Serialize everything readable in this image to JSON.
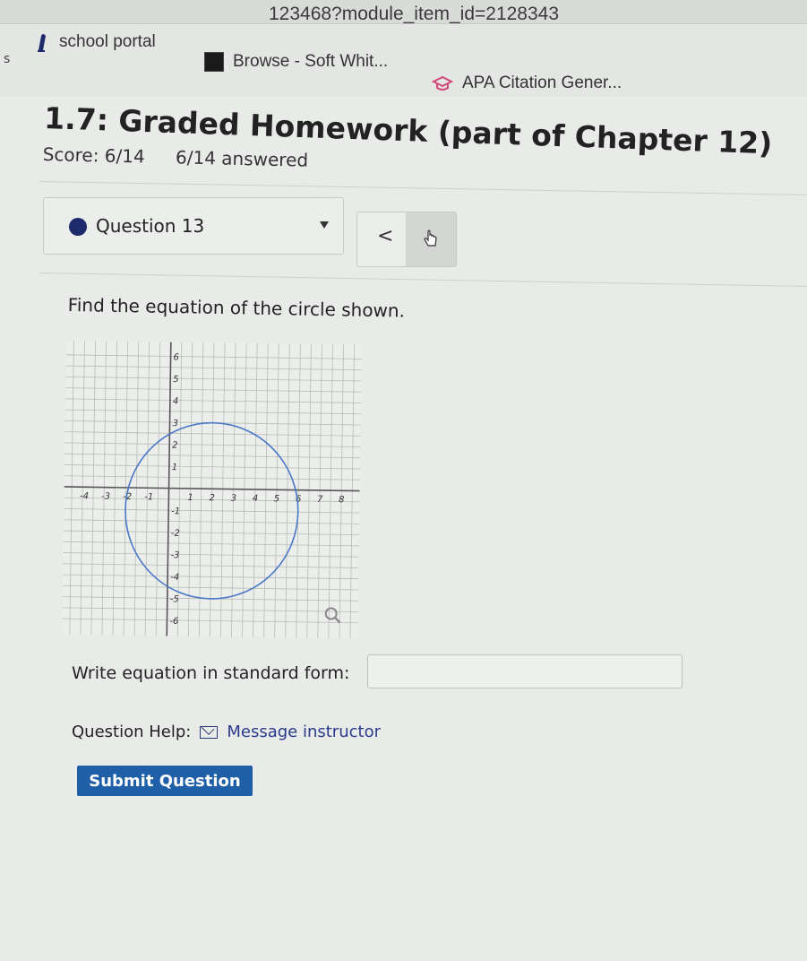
{
  "browser": {
    "url_fragment": "123468?module_item_id=2128343",
    "edge_char": "s",
    "bookmarks": [
      {
        "label": "school portal",
        "icon": "pen-icon"
      },
      {
        "label": "Browse - Soft Whit...",
        "icon": "black-square-icon"
      },
      {
        "label": "APA Citation Gener...",
        "icon": "graduation-cap-icon"
      }
    ]
  },
  "assignment": {
    "title": "1.7: Graded Homework (part of Chapter 12)",
    "score": "Score: 6/14",
    "answered": "6/14 answered"
  },
  "question_nav": {
    "label": "Question 13",
    "prev_symbol": "<",
    "next_symbol": "▷"
  },
  "question": {
    "prompt": "Find the equation of the circle shown.",
    "equation_label": "Write equation in standard form:",
    "equation_value": "",
    "help_label": "Question Help:",
    "help_link": "Message instructor",
    "submit_label": "Submit Question"
  },
  "graph": {
    "x_range": [
      -4,
      8
    ],
    "y_range": [
      -6,
      6
    ],
    "x_tick_labels": [
      "-4",
      "-3",
      "-2",
      "-1",
      "1",
      "2",
      "3",
      "4",
      "5",
      "6",
      "7",
      "8"
    ],
    "y_tick_labels": [
      "6",
      "5",
      "4",
      "3",
      "2",
      "1",
      "-1",
      "-2",
      "-3",
      "-4",
      "-5",
      "-6"
    ],
    "circle": {
      "center_x": 2,
      "center_y": -1,
      "radius": 4
    },
    "circle_color": "#4a78c8",
    "grid_color": "#b9bbb9",
    "axis_color": "#555555",
    "magnifier_icon": "magnifier-icon"
  },
  "colors": {
    "submit_bg": "#1f5fa8",
    "question_dot": "#1d2a6b",
    "link": "#2a3a8a"
  }
}
